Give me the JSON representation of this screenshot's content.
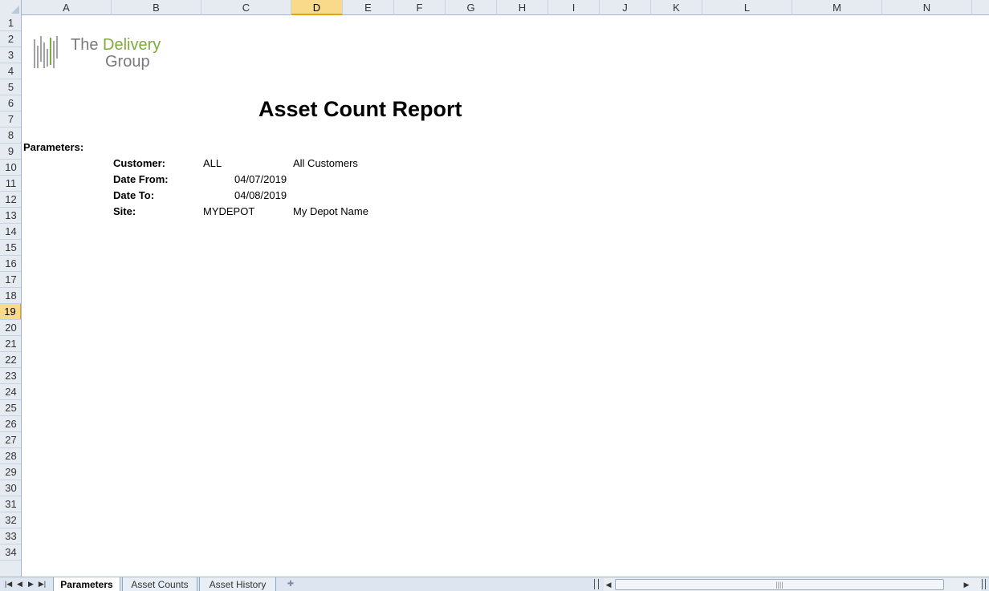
{
  "columns": [
    "A",
    "B",
    "C",
    "D",
    "E",
    "F",
    "G",
    "H",
    "I",
    "J",
    "K",
    "L",
    "M",
    "N"
  ],
  "selected_column": "D",
  "rows": [
    "1",
    "2",
    "3",
    "4",
    "5",
    "6",
    "7",
    "8",
    "9",
    "10",
    "11",
    "12",
    "13",
    "14",
    "15",
    "16",
    "17",
    "18",
    "19",
    "20",
    "21",
    "22",
    "23",
    "24",
    "25",
    "26",
    "27",
    "28",
    "29",
    "30",
    "31",
    "32",
    "33",
    "34"
  ],
  "selected_row": "19",
  "logo": {
    "line1_a": "The ",
    "line1_b": "Delivery",
    "line2": "Group",
    "accent_color": "#7cac3a"
  },
  "report": {
    "title": "Asset Count Report",
    "parameters_label": "Parameters:",
    "customer_label": "Customer:",
    "customer_code": "ALL",
    "customer_name": "All Customers",
    "date_from_label": "Date From:",
    "date_from": "04/07/2019",
    "date_to_label": "Date To:",
    "date_to": "04/08/2019",
    "site_label": "Site:",
    "site_code": "MYDEPOT",
    "site_name": "My Depot Name"
  },
  "sheet_tabs": [
    "Parameters",
    "Asset Counts",
    "Asset History"
  ],
  "active_tab": "Parameters",
  "nav_icons": [
    "first-sheet-icon",
    "prev-sheet-icon",
    "next-sheet-icon",
    "last-sheet-icon"
  ]
}
